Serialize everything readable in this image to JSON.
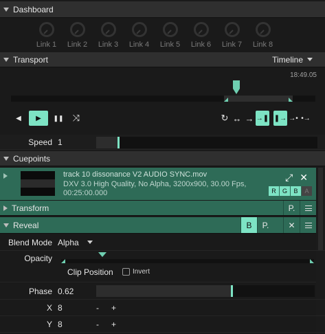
{
  "dashboard": {
    "title": "Dashboard",
    "links": [
      "Link 1",
      "Link 2",
      "Link 3",
      "Link 4",
      "Link 5",
      "Link 6",
      "Link 7",
      "Link 8"
    ]
  },
  "transport": {
    "title": "Transport",
    "mode": "Timeline",
    "timecode": "18:49.05",
    "controls": {
      "prev": "◀",
      "play": "▶",
      "pause": "❚❚",
      "shuffle": "⤨"
    },
    "right_controls": [
      "↻",
      "↔",
      "→",
      "→❚",
      "❚→",
      "→•",
      "•→"
    ]
  },
  "speed": {
    "label": "Speed",
    "value": "1"
  },
  "cuepoints": {
    "title": "Cuepoints"
  },
  "clip": {
    "name": "track 10 dissonance V2 AUDIO SYNC.mov",
    "info": "DXV 3.0 High Quality, No Alpha, 3200x900, 30.00 Fps, 00:25:00.000",
    "channels": [
      "R",
      "G",
      "B",
      "A"
    ],
    "expand_icon": "⤢",
    "close_icon": "✕"
  },
  "transform": {
    "title": "Transform",
    "p_label": "P."
  },
  "reveal": {
    "title": "Reveal",
    "b_label": "B",
    "p_label": "P.",
    "close_label": "✕"
  },
  "blend_mode": {
    "label": "Blend Mode",
    "value": "Alpha"
  },
  "opacity": {
    "label": "Opacity",
    "clip_position": "Clip Position",
    "invert": "Invert"
  },
  "phase": {
    "label": "Phase",
    "value": "0.62",
    "fraction": 0.62
  },
  "x": {
    "label": "X",
    "value": "8",
    "minus": "-",
    "plus": "+"
  },
  "y": {
    "label": "Y",
    "value": "8",
    "minus": "-",
    "plus": "+"
  }
}
